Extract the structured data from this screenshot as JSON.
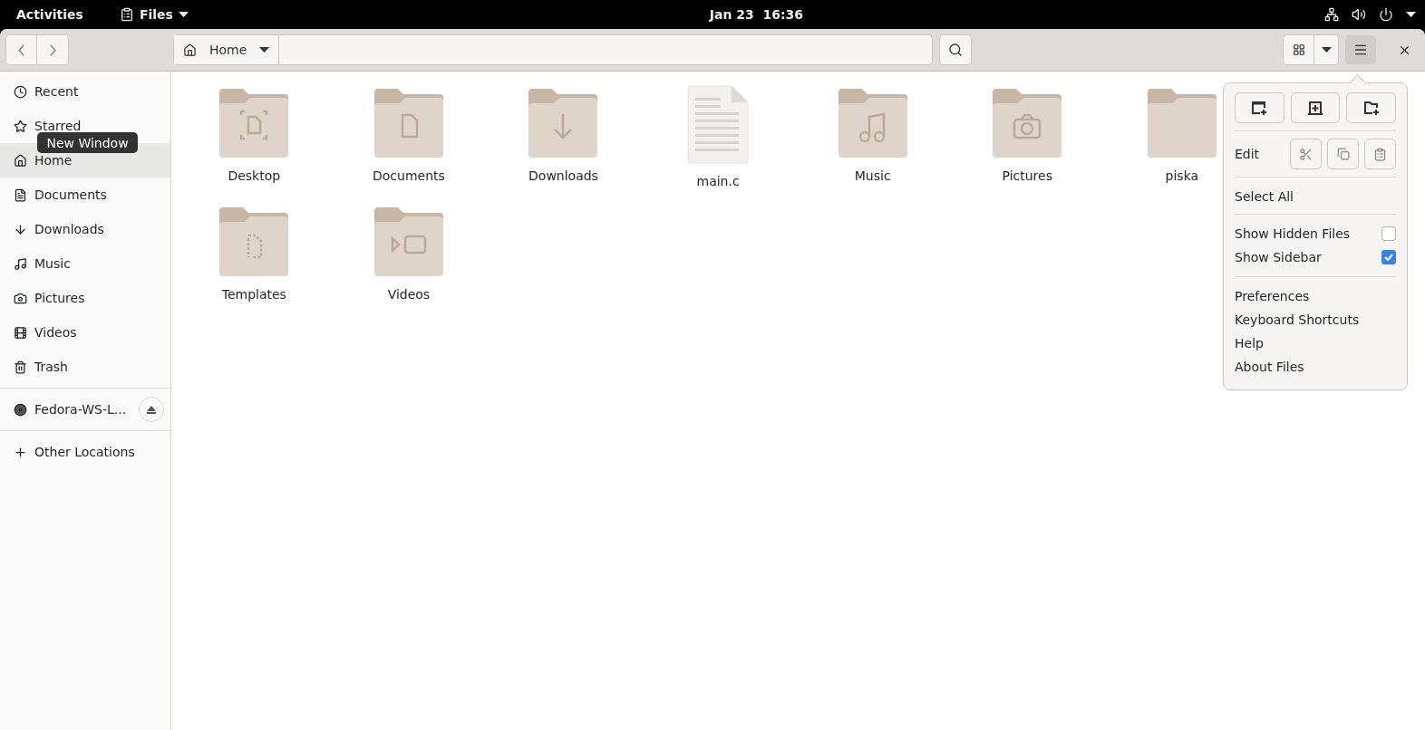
{
  "top_bar": {
    "activities": "Activities",
    "app_menu": "Files",
    "clock": "Jan 23  16:36"
  },
  "header": {
    "path_button": "Home"
  },
  "sidebar": {
    "items": [
      {
        "label": "Recent",
        "selected": false
      },
      {
        "label": "Starred",
        "selected": false
      },
      {
        "label": "Home",
        "selected": true
      },
      {
        "label": "Documents",
        "selected": false
      },
      {
        "label": "Downloads",
        "selected": false
      },
      {
        "label": "Music",
        "selected": false
      },
      {
        "label": "Pictures",
        "selected": false
      },
      {
        "label": "Videos",
        "selected": false
      },
      {
        "label": "Trash",
        "selected": false
      }
    ],
    "devices": [
      {
        "label": "Fedora-WS-L..."
      }
    ],
    "other": {
      "label": "Other Locations"
    }
  },
  "tooltip": "New Window",
  "files": [
    {
      "name": "Desktop",
      "kind": "folder"
    },
    {
      "name": "Documents",
      "kind": "folder"
    },
    {
      "name": "Downloads",
      "kind": "folder"
    },
    {
      "name": "main.c",
      "kind": "file"
    },
    {
      "name": "Music",
      "kind": "folder"
    },
    {
      "name": "Pictures",
      "kind": "folder"
    },
    {
      "name": "piska",
      "kind": "folder"
    },
    {
      "name": "Templates",
      "kind": "folder"
    },
    {
      "name": "Videos",
      "kind": "folder"
    }
  ],
  "menu": {
    "edit_label": "Edit",
    "select_all": "Select All",
    "toggles": [
      {
        "label": "Show Hidden Files",
        "checked": false
      },
      {
        "label": "Show Sidebar",
        "checked": true
      }
    ],
    "items": [
      "Preferences",
      "Keyboard Shortcuts",
      "Help",
      "About Files"
    ]
  }
}
